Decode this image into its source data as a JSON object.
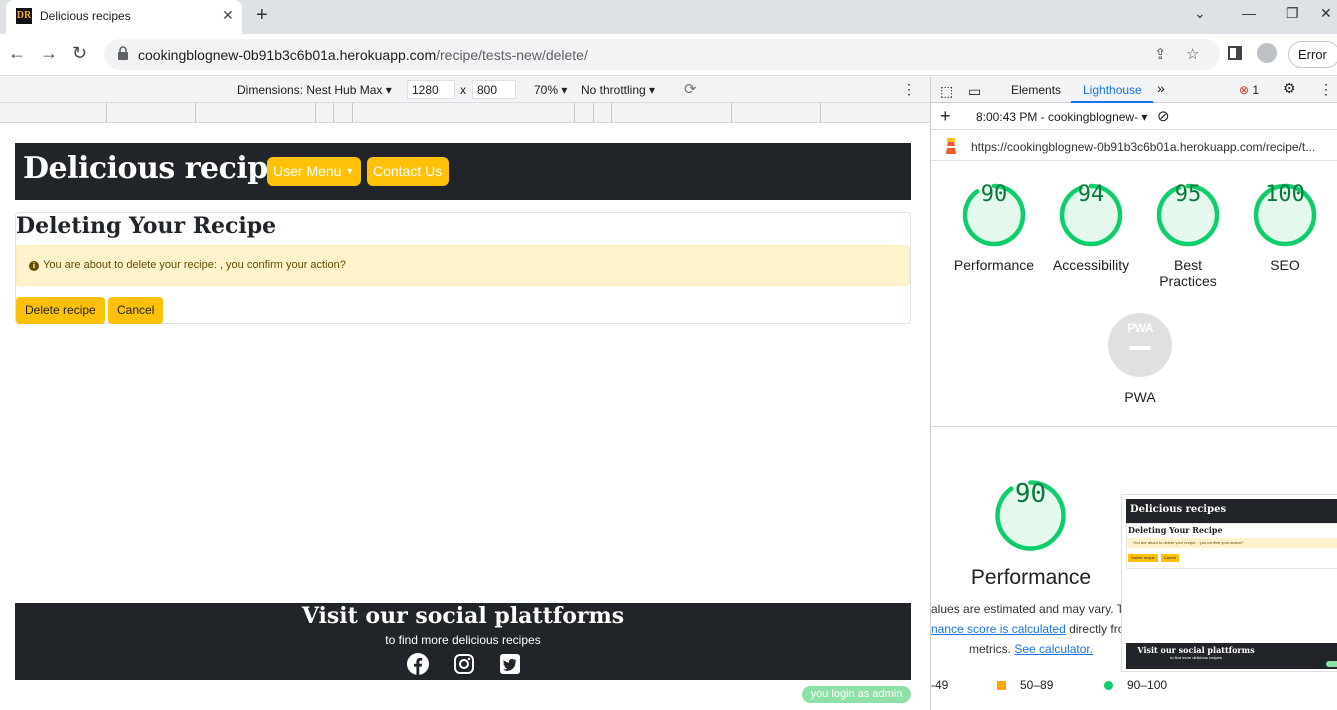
{
  "browser": {
    "tab_title": "Delicious recipes",
    "favicon_text": "DR",
    "url_host": "cookingblognew-0b91b3c6b01a.herokuapp.com",
    "url_path": "/recipe/tests-new/delete/",
    "error_label": "Error"
  },
  "device_toolbar": {
    "dimensions_label": "Dimensions: Nest Hub Max",
    "width": "1280",
    "height": "800",
    "times": "x",
    "zoom": "70%",
    "throttling": "No throttling"
  },
  "site": {
    "brand": "Delicious recipes",
    "user_menu": "User Menu",
    "contact": "Contact Us",
    "card_title": "Deleting Your Recipe",
    "alert_text": "You are about to delete your recipe: , you confirm your action?",
    "delete_label": "Delete recipe",
    "cancel_label": "Cancel",
    "footer_title": "Visit our social plattforms",
    "footer_sub": "to find more delicious recipes",
    "login_badge": "you login as admin"
  },
  "devtools": {
    "tab_elements": "Elements",
    "tab_lighthouse": "Lighthouse",
    "error_count": "1",
    "report_time": "8:00:43 PM - cookingblognew-",
    "report_url": "https://cookingblognew-0b91b3c6b01a.herokuapp.com/recipe/t...",
    "scores": [
      {
        "label": "Performance",
        "value": 90
      },
      {
        "label": "Accessibility",
        "value": 94
      },
      {
        "label": "Best Practices",
        "value": 95
      },
      {
        "label": "SEO",
        "value": 100
      }
    ],
    "pwa_label": "PWA",
    "pwa_badge": "PWA",
    "big_score": 90,
    "big_label": "Performance",
    "note_line1": "alues are estimated and may vary. Th",
    "note_link1": "nance score is calculated",
    "note_after1": " directly fro",
    "note_line3": "metrics. ",
    "note_link2": "See calculator.",
    "legend": [
      {
        "label": "-49",
        "color": "#ff3333"
      },
      {
        "label": "50–89",
        "color": "#ffa400"
      },
      {
        "label": "90–100",
        "color": "#0cce6b"
      }
    ],
    "thumb": {
      "brand": "Delicious recipes",
      "title": "Deleting Your Recipe",
      "alert": "You are about to delete your recipe: , you confirm your action?",
      "delete_label": "Delete recipe",
      "cancel_label": "Cancel",
      "footer_title": "Visit our social plattforms",
      "footer_sub": "to find more delicious recipes"
    }
  },
  "colors": {
    "accent_yellow": "#ffc107",
    "dark_nav": "#212529",
    "score_green": "#0cce6b"
  }
}
